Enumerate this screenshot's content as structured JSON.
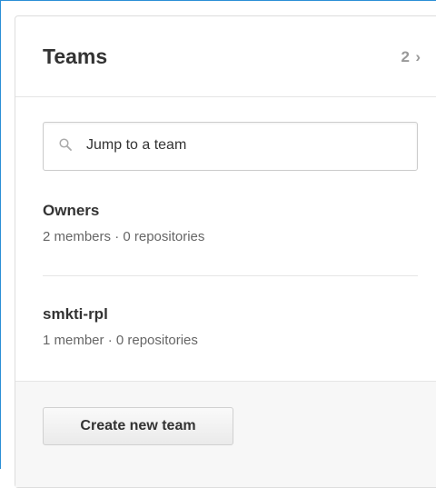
{
  "panel": {
    "title": "Teams",
    "team_count": "2",
    "count_chevron": "›"
  },
  "search": {
    "placeholder": "Jump to a team",
    "icon": "search-icon"
  },
  "teams": [
    {
      "name": "Owners",
      "meta": "2 members · 0 repositories"
    },
    {
      "name": "smkti-rpl",
      "meta": "1 member · 0 repositories"
    }
  ],
  "footer": {
    "create_label": "Create new team"
  },
  "colors": {
    "window_border": "#2b8fd6",
    "panel_border": "#dddddd",
    "footer_background": "#f7f7f7",
    "text": "#333333",
    "muted_text": "#666666",
    "count_text": "#999999"
  }
}
